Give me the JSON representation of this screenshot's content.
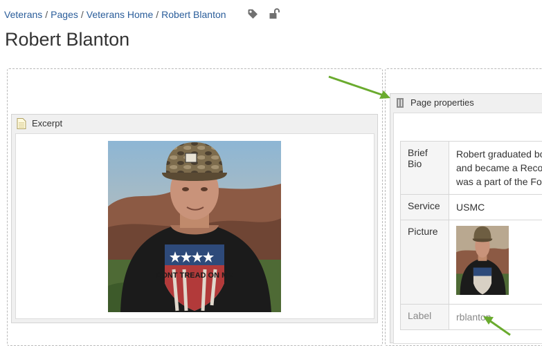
{
  "breadcrumb": {
    "items": [
      "Veterans",
      "Pages",
      "Veterans Home",
      "Robert Blanton"
    ],
    "separator": "/",
    "icons": [
      "tag-icon",
      "unlock-icon"
    ]
  },
  "page": {
    "title": "Robert Blanton"
  },
  "excerpt": {
    "header": "Excerpt",
    "icon": "excerpt-page-icon",
    "photo": "portrait photo of a man in a camouflage cap and black t-shirt",
    "shirt_text": "DONT TREAD ON ME"
  },
  "page_properties": {
    "header": "Page properties",
    "icon": "page-properties-icon",
    "rows": [
      {
        "label": "Brief Bio",
        "lines": [
          "Robert graduated bo",
          "and became a Reco",
          "was a part of the Fo"
        ]
      },
      {
        "label": "Service",
        "value": "USMC"
      },
      {
        "label": "Picture",
        "value": ""
      },
      {
        "label": "Label",
        "value": "rblanton"
      }
    ]
  },
  "colors": {
    "link": "#2a5d9a",
    "annotation_arrow": "#6aab2e",
    "panel_border": "#b8b8b8"
  }
}
